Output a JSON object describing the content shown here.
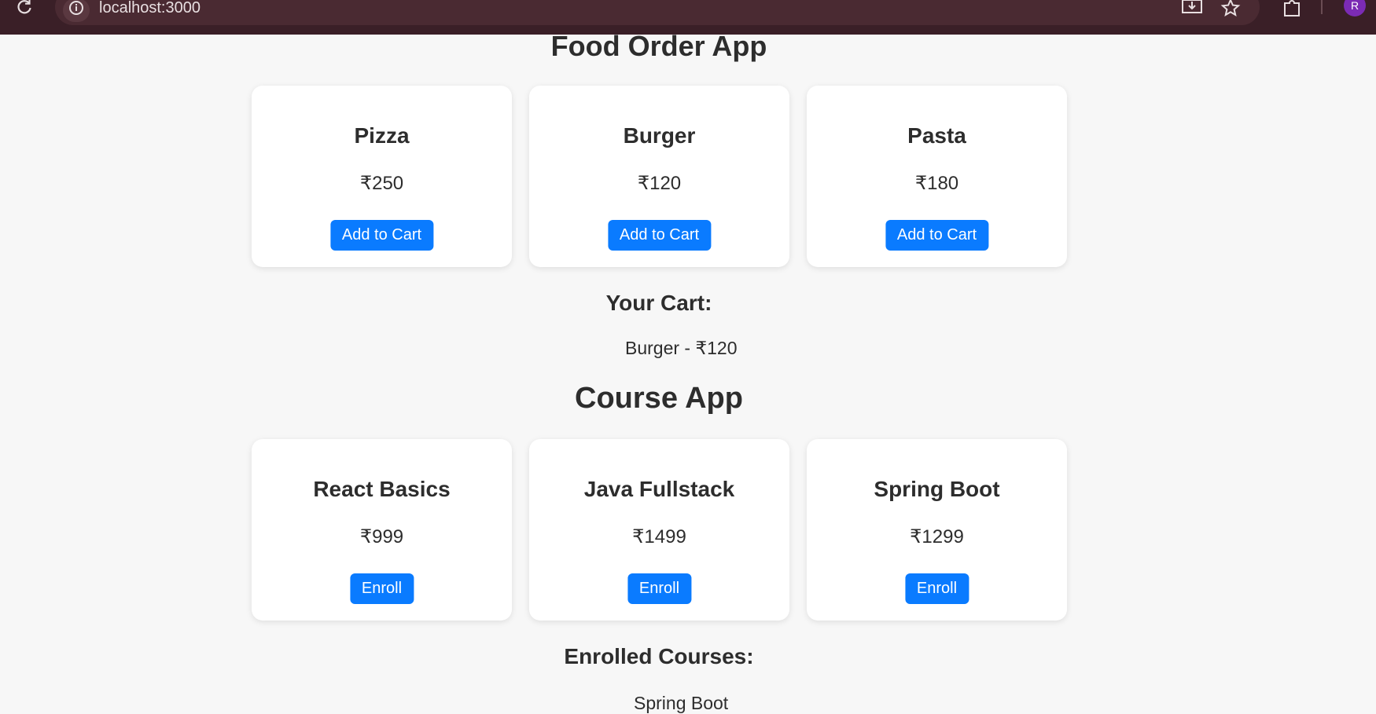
{
  "browser": {
    "url": "localhost:3000",
    "avatar_letter": "R"
  },
  "food": {
    "title": "Food Order App",
    "items": [
      {
        "name": "Pizza",
        "price": "₹250",
        "button": "Add to Cart"
      },
      {
        "name": "Burger",
        "price": "₹120",
        "button": "Add to Cart"
      },
      {
        "name": "Pasta",
        "price": "₹180",
        "button": "Add to Cart"
      }
    ],
    "cart_heading": "Your Cart:",
    "cart_items": [
      "Burger - ₹120"
    ]
  },
  "course": {
    "title": "Course App",
    "items": [
      {
        "name": "React Basics",
        "price": "₹999",
        "button": "Enroll"
      },
      {
        "name": "Java Fullstack",
        "price": "₹1499",
        "button": "Enroll"
      },
      {
        "name": "Spring Boot",
        "price": "₹1299",
        "button": "Enroll"
      }
    ],
    "enrolled_heading": "Enrolled Courses:",
    "enrolled_items": [
      "Spring Boot"
    ]
  },
  "colors": {
    "accent": "#0a7bff",
    "page_bg": "#f7f7f7",
    "browser_bar": "#3a1f27"
  }
}
